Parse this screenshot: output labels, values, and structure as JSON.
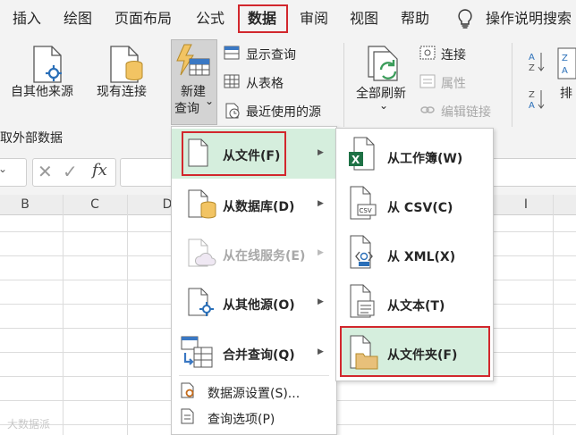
{
  "menubar": {
    "tabs": [
      "插入",
      "绘图",
      "页面布局",
      "公式",
      "数据",
      "审阅",
      "视图",
      "帮助"
    ],
    "active_tab": "数据",
    "tell_me": "操作说明搜索"
  },
  "ribbon": {
    "from_other_sources": "自其他来源",
    "existing_connections": "现有连接",
    "new_query_line1": "新建",
    "new_query_line2": "查询",
    "new_query_caret": "⌄",
    "show_queries": "显示查询",
    "from_table": "从表格",
    "recent_sources": "最近使用的源",
    "refresh_all": "全部刷新",
    "refresh_caret": "⌄",
    "connections": "连接",
    "properties": "属性",
    "edit_links": "编辑链接",
    "sort_partial": "排",
    "group_label": "获取外部数据"
  },
  "formula_bar": {
    "fx": "fx"
  },
  "columns": [
    "B",
    "C",
    "D",
    "I"
  ],
  "menu_new_query": {
    "items": [
      {
        "label": "从文件(F)",
        "has_submenu": true,
        "highlighted": true,
        "disabled": false
      },
      {
        "label": "从数据库(D)",
        "has_submenu": true,
        "highlighted": false,
        "disabled": false
      },
      {
        "label": "从在线服务(E)",
        "has_submenu": true,
        "highlighted": false,
        "disabled": true
      },
      {
        "label": "从其他源(O)",
        "has_submenu": true,
        "highlighted": false,
        "disabled": false
      },
      {
        "label": "合并查询(Q)",
        "has_submenu": true,
        "highlighted": false,
        "disabled": false
      }
    ],
    "footer_items": [
      "数据源设置(S)...",
      "查询选项(P)"
    ]
  },
  "submenu_from_file": {
    "items": [
      {
        "label": "从工作簿(W)",
        "highlighted": false
      },
      {
        "label": "从 CSV(C)",
        "highlighted": false
      },
      {
        "label": "从 XML(X)",
        "highlighted": false
      },
      {
        "label": "从文本(T)",
        "highlighted": false
      },
      {
        "label": "从文件夹(F)",
        "highlighted": true
      }
    ],
    "icon_tags": {
      "csv": "CSV"
    }
  },
  "colors": {
    "accent_red": "#d2272d",
    "highlight": "#d5eedd",
    "excel_green": "#1e7145"
  },
  "watermark": "大数据派"
}
